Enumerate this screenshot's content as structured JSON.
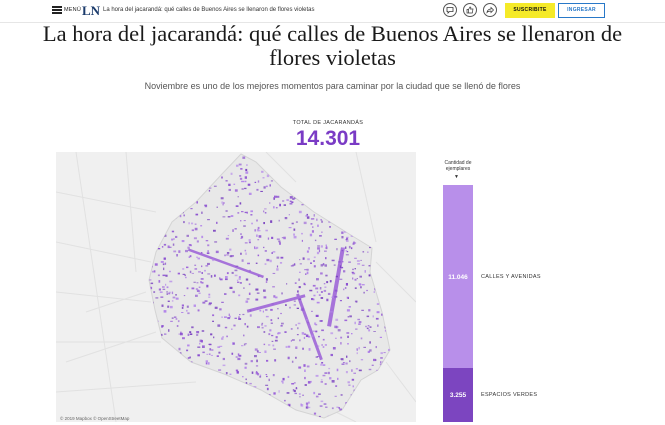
{
  "header": {
    "menu_label": "MENÚ",
    "logo_text": "LN",
    "nav_title": "La hora del jacarandá: qué calles de Buenos Aires se llenaron de flores violetas",
    "subscribe_label": "SUSCRIBITE",
    "login_label": "INGRESAR",
    "icons": [
      "comment-icon",
      "like-icon",
      "share-icon"
    ]
  },
  "article": {
    "title": "La hora del jacarandá: qué calles de Buenos Aires se llenaron de flores violetas",
    "subtitle": "Noviembre es uno de los mejores momentos para caminar por la ciudad que se llenó de flores"
  },
  "total": {
    "label": "TOTAL DE JACARANDÁS",
    "value": "14.301"
  },
  "map": {
    "attribution": "© 2019 Mapbox © OpenStreetMap"
  },
  "bar": {
    "title": "Cantidad de ejemplares",
    "arrow": "▼",
    "segments": [
      {
        "value": "11.046",
        "label": "CALLES Y AVENIDAS",
        "color": "#b88fea"
      },
      {
        "value": "3.255",
        "label": "ESPACIOS VERDES",
        "color": "#7c45c0"
      }
    ]
  },
  "colors": {
    "accent": "#7a3bc5",
    "subscribe": "#f5ea28",
    "login": "#2878c8"
  }
}
